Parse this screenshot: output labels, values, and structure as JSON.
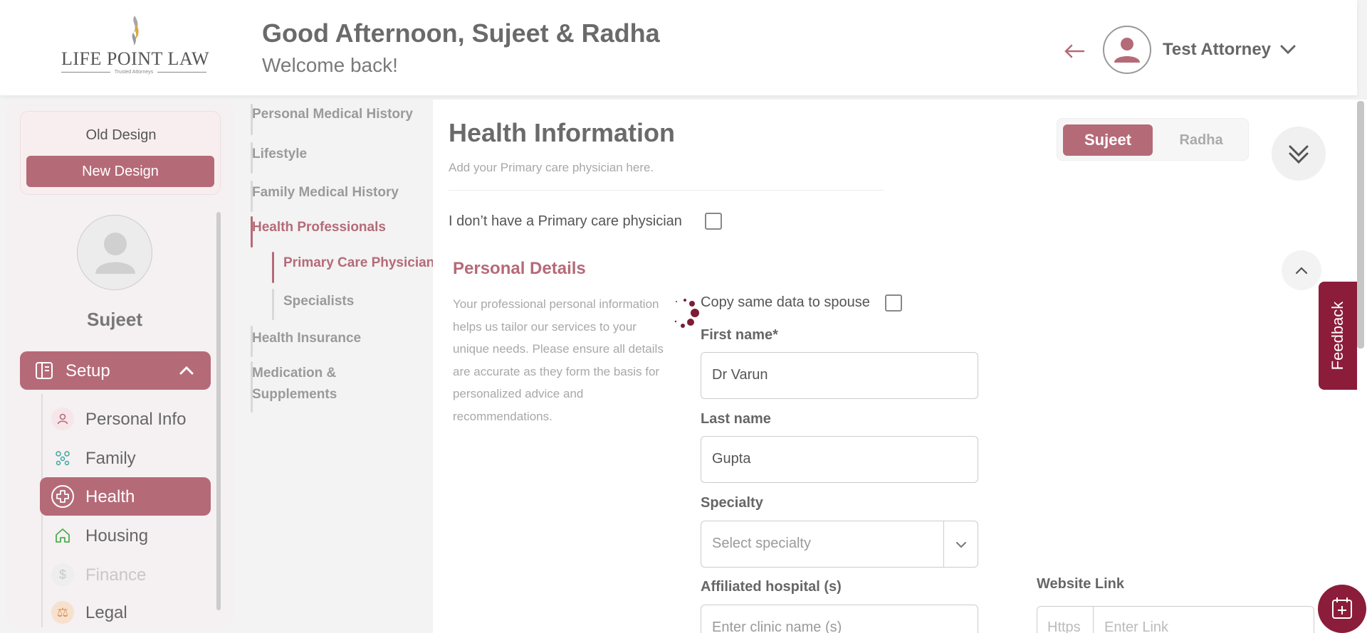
{
  "brand": {
    "name": "LIFE POINT LAW",
    "tagline": "Trusted Attorneys"
  },
  "header": {
    "greeting": "Good Afternoon, Sujeet & Radha",
    "welcome": "Welcome back!",
    "user_name": "Test Attorney"
  },
  "sidebar": {
    "old_design": "Old Design",
    "new_design": "New Design",
    "profile_name": "Sujeet",
    "setup_label": "Setup",
    "items": [
      {
        "label": "Personal Info",
        "icon": "person-icon"
      },
      {
        "label": "Family",
        "icon": "family-icon"
      },
      {
        "label": "Health",
        "icon": "health-cross-icon",
        "active": true
      },
      {
        "label": "Housing",
        "icon": "home-icon"
      },
      {
        "label": "Finance",
        "icon": "dollar-icon",
        "disabled": true
      },
      {
        "label": "Legal",
        "icon": "legal-icon"
      }
    ]
  },
  "section_nav": {
    "items": [
      "Personal Medical History",
      "Lifestyle",
      "Family Medical History",
      "Health Professionals",
      "Primary Care Physician",
      "Specialists",
      "Health Insurance",
      "Medication &",
      "Supplements"
    ],
    "active": "Health Professionals",
    "active_sub": "Primary Care Physician"
  },
  "main": {
    "title": "Health Information",
    "subtitle": "Add your Primary care physician here.",
    "toggle": {
      "selected": "Sujeet",
      "other": "Radha"
    },
    "no_pcp_label": "I don’t have a Primary care physician",
    "no_pcp_checked": false,
    "personal_details": {
      "title": "Personal Details",
      "description": "Your professional personal information helps us tailor our services to your unique needs. Please ensure all details are accurate as they form the basis for personalized advice and recommendations."
    },
    "copy_spouse_label": "Copy same data to spouse",
    "copy_spouse_checked": false,
    "fields": {
      "first_name": {
        "label": "First name*",
        "value": "Dr Varun"
      },
      "last_name": {
        "label": "Last name",
        "value": "Gupta"
      },
      "specialty": {
        "label": "Specialty",
        "placeholder": "Select specialty"
      },
      "hospital": {
        "label": "Affiliated hospital (s)",
        "placeholder": "Enter clinic name (s)"
      },
      "website": {
        "label": "Website Link",
        "prefix": "Https",
        "placeholder": "Enter Link"
      }
    }
  },
  "feedback_label": "Feedback",
  "colors": {
    "accent": "#b56a78",
    "brand_dark": "#8b1d3a"
  }
}
